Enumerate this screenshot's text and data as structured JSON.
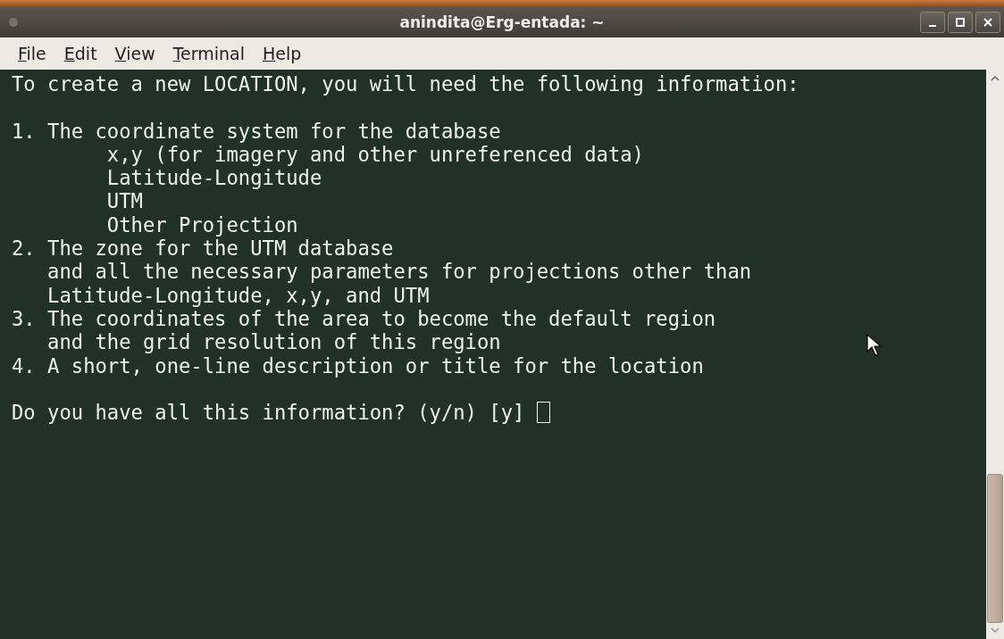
{
  "window": {
    "title": "anindita@Erg-entada: ~"
  },
  "menu": [
    {
      "label": "File"
    },
    {
      "label": "Edit"
    },
    {
      "label": "View"
    },
    {
      "label": "Terminal"
    },
    {
      "label": "Help"
    }
  ],
  "terminal": {
    "blocks": [
      [
        "To create a new LOCATION, you will need the following information:"
      ],
      [
        "1. The coordinate system for the database",
        "        x,y (for imagery and other unreferenced data)",
        "        Latitude-Longitude",
        "        UTM",
        "        Other Projection",
        "2. The zone for the UTM database",
        "   and all the necessary parameters for projections other than",
        "   Latitude-Longitude, x,y, and UTM",
        "3. The coordinates of the area to become the default region",
        "   and the grid resolution of this region",
        "4. A short, one-line description or title for the location"
      ],
      [
        "Do you have all this information? (y/n) [y] "
      ]
    ],
    "cursor": true
  }
}
